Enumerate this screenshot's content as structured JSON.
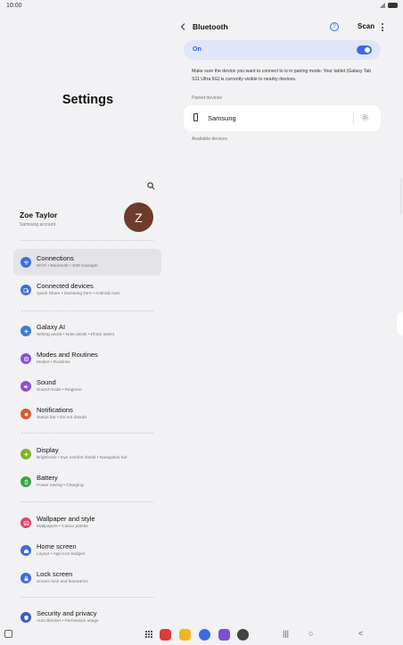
{
  "status": {
    "time": "10:00"
  },
  "left": {
    "title": "Settings",
    "profile": {
      "name": "Zoe Taylor",
      "subtitle": "Samsung account",
      "initial": "Z"
    },
    "items": [
      {
        "title": "Connections",
        "subtitle": "Wi-Fi • Bluetooth • SIM manager",
        "icon": "wifi-icon",
        "color": "#3b6de0",
        "selected": true
      },
      {
        "title": "Connected devices",
        "subtitle": "Quick Share • Samsung DeX • Android Auto",
        "icon": "devices-icon",
        "color": "#3b6de0"
      },
      {
        "title": "Galaxy AI",
        "subtitle": "Writing assist • Note assist • Photo assist",
        "icon": "ai-icon",
        "color": "#3b7fd6"
      },
      {
        "title": "Modes and Routines",
        "subtitle": "Modes • Routines",
        "icon": "modes-icon",
        "color": "#8a4fd6"
      },
      {
        "title": "Sound",
        "subtitle": "Sound mode • Ringtone",
        "icon": "sound-icon",
        "color": "#8a4fd6"
      },
      {
        "title": "Notifications",
        "subtitle": "Status bar • Do not disturb",
        "icon": "bell-icon",
        "color": "#e0572f"
      },
      {
        "title": "Display",
        "subtitle": "Brightness • Eye comfort shield • Navigation bar",
        "icon": "sun-icon",
        "color": "#7ab325"
      },
      {
        "title": "Battery",
        "subtitle": "Power saving • Charging",
        "icon": "battery-icon",
        "color": "#3aa34b"
      },
      {
        "title": "Wallpaper and style",
        "subtitle": "Wallpapers • Colour palette",
        "icon": "wallpaper-icon",
        "color": "#e0456a"
      },
      {
        "title": "Home screen",
        "subtitle": "Layout • App icon badges",
        "icon": "home-icon",
        "color": "#3b6de0"
      },
      {
        "title": "Lock screen",
        "subtitle": "Screen lock and biometrics",
        "icon": "lock-icon",
        "color": "#3b6de0"
      },
      {
        "title": "Security and privacy",
        "subtitle": "Auto Blocker • Permission usage",
        "icon": "shield-icon",
        "color": "#3b5fc9"
      }
    ]
  },
  "bluetooth": {
    "title": "Bluetooth",
    "scan_label": "Scan",
    "toggle_label": "On",
    "toggle_on": true,
    "description": "Make sure the device you want to connect to is in pairing mode. Your tablet (Galaxy Tab S11 Ultra 5G) is currently visible to nearby devices.",
    "paired_header": "Paired devices",
    "paired_devices": [
      {
        "name": "Samsung"
      }
    ],
    "available_header": "Available devices"
  },
  "colors": {
    "accent": "#3b6de0",
    "toggle_bg": "#dfe6f7"
  }
}
